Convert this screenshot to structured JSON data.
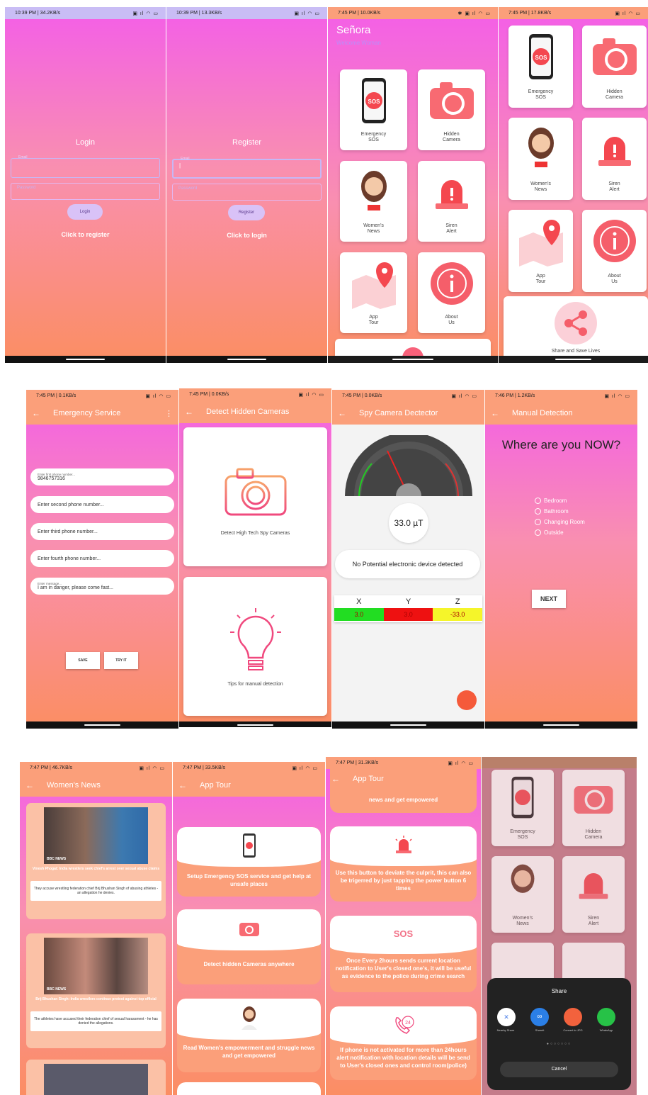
{
  "status": {
    "s1": "10:39 PM | 34.2KB/s",
    "s2": "10:39 PM | 13.3KB/s",
    "s3": "7:45 PM | 10.0KB/s",
    "s4": "7:45 PM | 17.8KB/s",
    "s5": "7:45 PM | 0.1KB/s",
    "s6": "7:45 PM | 0.0KB/s",
    "s7": "7:45 PM | 0.0KB/s",
    "s8": "7:46 PM | 1.2KB/s",
    "s9": "7:47 PM | 46.7KB/s",
    "s10": "7:47 PM | 33.5KB/s",
    "s11": "7:47 PM | 31.3KB/s"
  },
  "login": {
    "title": "Login",
    "email_label": "Email",
    "password_placeholder": "Password",
    "button": "Login",
    "link": "Click to register"
  },
  "register": {
    "title": "Register",
    "email_label": "Email",
    "password_placeholder": "Password",
    "button": "Register",
    "link": "Click to login"
  },
  "home": {
    "app_name": "Señora",
    "subtitle": "Welcome Woman",
    "tiles": [
      {
        "l1": "Emergency",
        "l2": "SOS"
      },
      {
        "l1": "Hidden",
        "l2": "Camera"
      },
      {
        "l1": "Women's",
        "l2": "News"
      },
      {
        "l1": "Siren",
        "l2": "Alert"
      },
      {
        "l1": "App",
        "l2": "Tour"
      },
      {
        "l1": "About",
        "l2": "Us"
      }
    ],
    "share": "Share and Save Lives",
    "sos_text": "SOS",
    "news_badge": "NEWS"
  },
  "emergency": {
    "title": "Emergency Service",
    "menu": "⋮",
    "f1_label": "Enter first phone number...",
    "f1_value": "9846757316",
    "f2": "Enter second phone number...",
    "f3": "Enter third phone number...",
    "f4": "Enter fourth phone number...",
    "msg_label": "Enter message...",
    "msg_value": "I am in danger, please come fast...",
    "save": "SAVE",
    "try": "TRY IT"
  },
  "hidden": {
    "title": "Detect Hidden Cameras",
    "card1": "Detect High Tech Spy Cameras",
    "card2": "Tips for manual detection"
  },
  "spy": {
    "title": "Spy Camera Dectector",
    "reading": "33.0 µT",
    "message": "No Potential electronic device detected",
    "x_label": "X",
    "y_label": "Y",
    "z_label": "Z",
    "x": "3.0",
    "y": "3.0",
    "z": "-33.0"
  },
  "manual": {
    "title": "Manual Detection",
    "question": "Where are you NOW?",
    "options": [
      "Bedroom",
      "Bathroom",
      "Changing Room",
      "Outside"
    ],
    "next": "NEXT"
  },
  "news": {
    "title": "Women's News",
    "n1_head": "Vinesh Phogat: India wrestlers seek chief's arrest over sexual abuse claims",
    "n1_body": "They accuse wrestling federation chief Brij Bhushan Singh of abusing athletes - an allegation he denies.",
    "n2_head": "Brij Bhushan Singh: India wrestlers continue protest against top official",
    "n2_body": "The athletes have accused their federation chief of sexual harassment - he has denied the allegations.",
    "bbc": "BBC NEWS"
  },
  "tour": {
    "title": "App Tour",
    "t1": "Setup Emergency SOS service and get help at unsafe places",
    "t2": "Detect hidden Cameras anywhere",
    "t3": "Read Women's empowerment and struggle news and get empowered"
  },
  "tour2": {
    "title": "App Tour",
    "t0": "news and get empowered",
    "t1": "Use this button to deviate the culprit, this can also be trigerred by just tapping the power button 6 times",
    "t2": "Once Every 2hours sends current location notification to User's closed one's, it will be useful as evidence to the police during crime search",
    "t3": "If phone is not activated for more than 24hours alert notification with location details will be send to User's closed ones and control room(police)",
    "sos": "SOS",
    "h24": "24"
  },
  "share": {
    "title": "Share",
    "apps": [
      "Nearby Share",
      "Shareit",
      "Convert to JPG",
      "WhatsApp"
    ],
    "cancel": "Cancel"
  },
  "colors": {
    "pink": "#f35ee8",
    "orange": "#fb8e63",
    "bar": "#fb9f7a",
    "green": "#22dd22",
    "red": "#ee1111",
    "yellow": "#f5f52a"
  }
}
